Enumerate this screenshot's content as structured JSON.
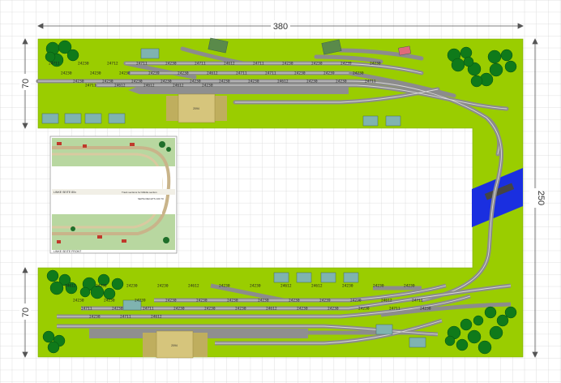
{
  "dimensions": {
    "width_label": "380",
    "height_label": "250",
    "left_top_label": "70",
    "left_bottom_label": "70"
  },
  "colors": {
    "grass": "#9acd00",
    "track": "#8c8c8c",
    "rail": "#d9d9d9",
    "platform": "#8f8f8f",
    "station": "#d2c37a",
    "water": "#1a2fe0",
    "tree_dark": "#0f7a1a",
    "tree_light": "#2aa02a",
    "building_roof": "#6aa9a4",
    "grid": "#d8d8d8"
  },
  "station_labels": {
    "top": "2094",
    "bottom": "2094"
  },
  "track_labels": {
    "top": [
      "24711",
      "24230",
      "24712",
      "24711",
      "24230",
      "24711",
      "24612",
      "24711",
      "24230",
      "24230",
      "24239",
      "24230",
      "24230",
      "24230",
      "24230",
      "24239",
      "24230",
      "24612",
      "24711",
      "24711",
      "24230",
      "24239",
      "24230",
      "24230",
      "24230",
      "24230",
      "24230",
      "24230",
      "24230",
      "24230",
      "24612",
      "24230",
      "24230",
      "24711",
      "24711",
      "24612",
      "24612",
      "24612",
      "24230"
    ],
    "bottom": [
      "24612",
      "24230",
      "24230",
      "24230",
      "24612",
      "24230",
      "24230",
      "24612",
      "24612",
      "24230",
      "24230",
      "24230",
      "24230",
      "24230",
      "24239",
      "24230",
      "24230",
      "24230",
      "24230",
      "24230",
      "24239",
      "24230",
      "24612",
      "24711",
      "24711",
      "24230",
      "24711",
      "24230",
      "24230",
      "24230",
      "24612",
      "24230",
      "24230",
      "24230",
      "24711",
      "24230",
      "24230",
      "24711",
      "24612"
    ]
  },
  "inset": {
    "caption_top": "LINKE SEITE 80x",
    "caption_mid": "Track sections for Middle section",
    "caption_right": "SEITE RECHTS 100 70",
    "caption_bottom": "LINKE SEITE FRONT"
  }
}
